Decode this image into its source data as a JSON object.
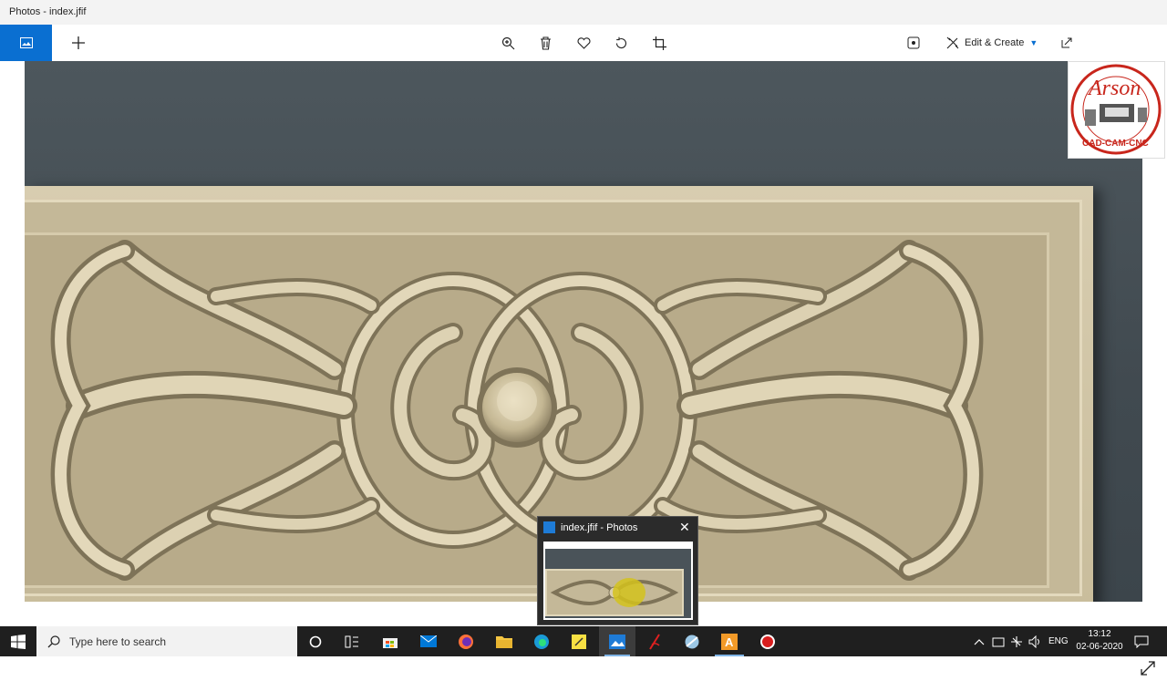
{
  "window": {
    "title": "Photos - index.jfif"
  },
  "toolbar": {
    "edit_create_label": "Edit & Create",
    "tools": [
      "zoom-in-icon",
      "delete-icon",
      "favorite-icon",
      "rotate-icon",
      "crop-icon"
    ]
  },
  "logo": {
    "text_top": "Arson",
    "text_bottom": "CAD-CAM-CNC"
  },
  "taskbar": {
    "search_placeholder": "Type here to search",
    "language": "ENG",
    "time": "13:12",
    "date": "02-06-2020"
  },
  "preview": {
    "title": "index.jfif - Photos"
  },
  "colors": {
    "accent": "#0a6fd1",
    "carving": "#c9bd9c",
    "background": "#454e54",
    "taskbar": "#1f1f1f"
  }
}
